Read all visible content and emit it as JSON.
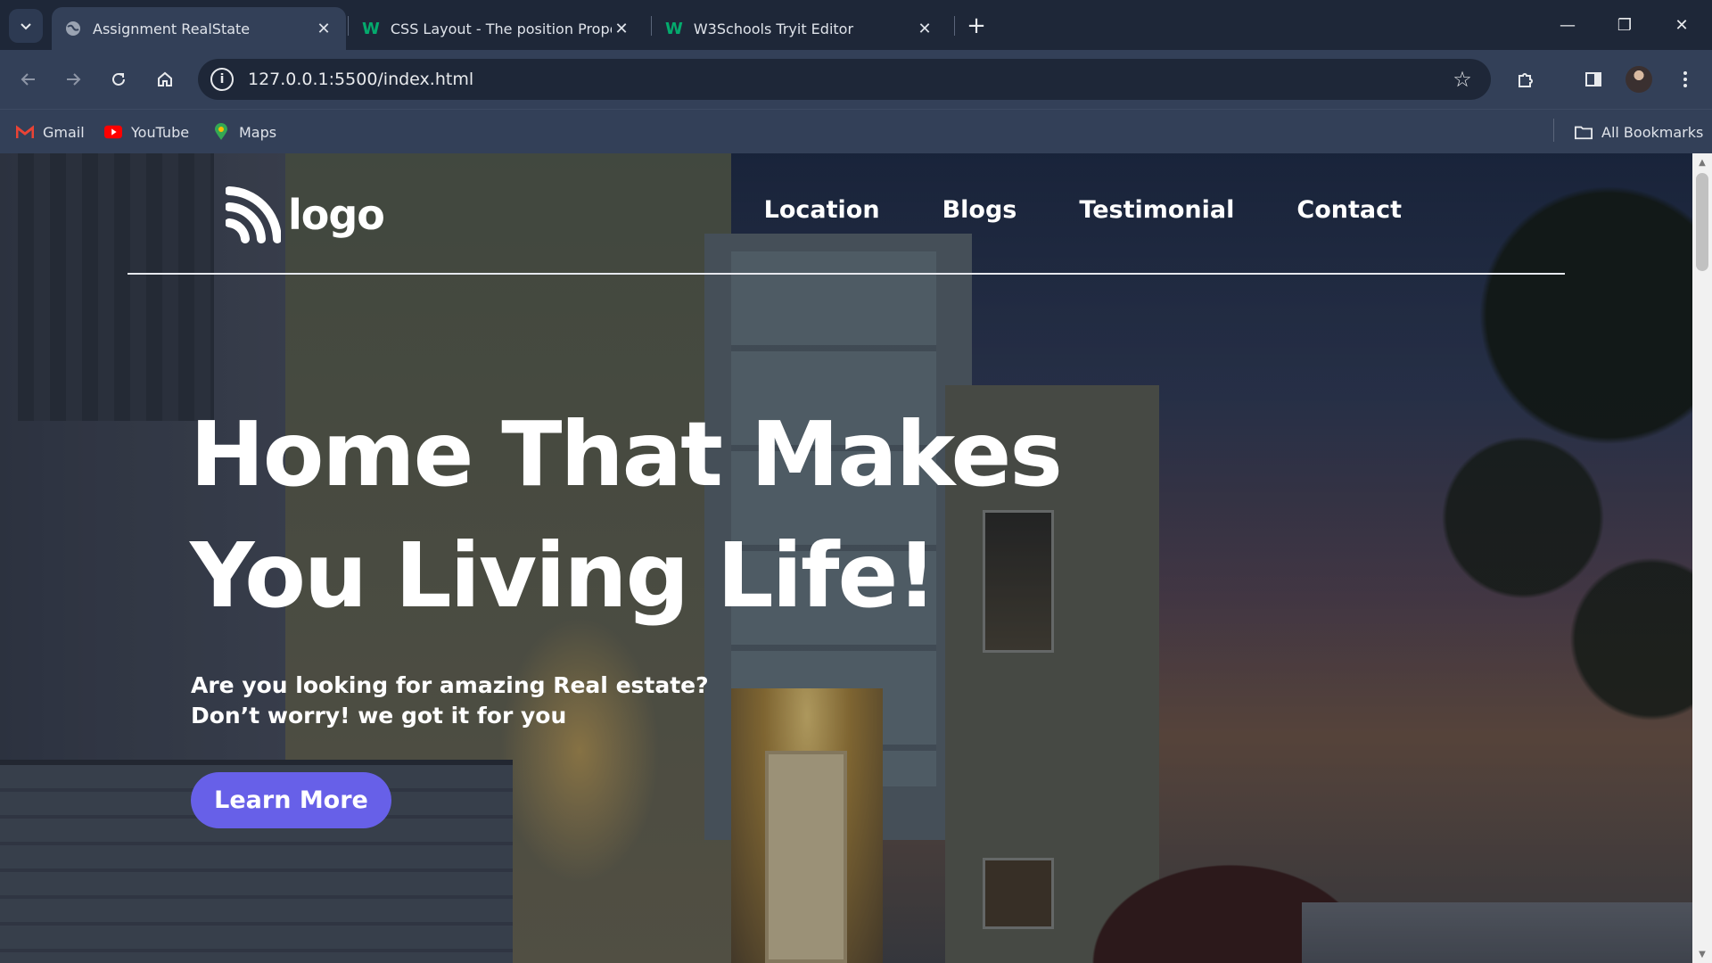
{
  "browser": {
    "tabs": [
      {
        "title": "Assignment RealState",
        "icon": "globe-icon",
        "active": true
      },
      {
        "title": "CSS Layout - The position Property",
        "icon": "w3schools-icon",
        "active": false
      },
      {
        "title": "W3Schools Tryit Editor",
        "icon": "w3schools-icon",
        "active": false
      }
    ],
    "url": "127.0.0.1:5500/index.html",
    "bookmarks": [
      {
        "label": "Gmail",
        "icon": "gmail-icon"
      },
      {
        "label": "YouTube",
        "icon": "youtube-icon"
      },
      {
        "label": "Maps",
        "icon": "maps-icon"
      }
    ],
    "all_bookmarks": "All Bookmarks",
    "colors": {
      "chrome_dark": "#1e2738",
      "chrome": "#334058"
    }
  },
  "site": {
    "logo_text": "logo",
    "nav": [
      "Location",
      "Blogs",
      "Testimonial",
      "Contact"
    ],
    "hero_title_line1": "Home That Makes",
    "hero_title_line2": "You Living Life!",
    "hero_subtitle": "Are you looking for amazing Real estate? Don’t worry! we got it for you",
    "cta_label": "Learn More",
    "colors": {
      "accent": "#6760e8",
      "text": "#ffffff"
    }
  }
}
